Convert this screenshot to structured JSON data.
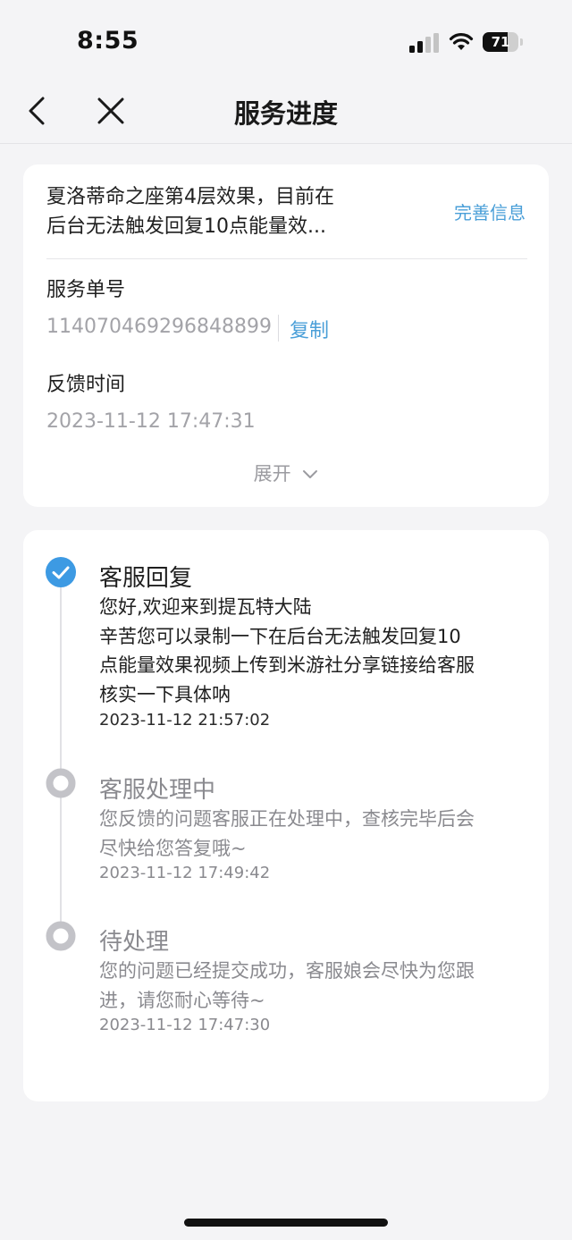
{
  "status_bar": {
    "time": "8:55",
    "battery_level": "71",
    "icons": [
      "signal-icon",
      "wifi-icon",
      "battery-icon"
    ]
  },
  "nav": {
    "title": "服务进度",
    "icons": [
      "back-icon",
      "close-icon"
    ]
  },
  "ticket": {
    "title_line1": "夏洛蒂命之座第4层效果，目前在",
    "title_line2": "后台无法触发回复10点能量效...",
    "complete_info_label": "完善信息",
    "service_number_label": "服务单号",
    "service_number": "114070469296848899",
    "copy_label": "复制",
    "feedback_time_label": "反馈时间",
    "feedback_time": "2023-11-12 17:47:31",
    "expand_label": "展开"
  },
  "timeline": [
    {
      "status": "客服回复",
      "desc_lines": [
        "您好,欢迎来到提瓦特大陆",
        "辛苦您可以录制一下在后台无法触发回复10",
        "点能量效果视频上传到米游社分享链接给客服",
        "核实一下具体呐"
      ],
      "time": "2023-11-12 21:57:02",
      "state": "done"
    },
    {
      "status": "客服处理中",
      "desc_lines": [
        "您反馈的问题客服正在处理中，查核完毕后会",
        "尽快给您答复哦~"
      ],
      "time": "2023-11-12 17:49:42",
      "state": "pending"
    },
    {
      "status": "待处理",
      "desc_lines": [
        "您的问题已经提交成功，客服娘会尽快为您跟",
        "进，请您耐心等待~"
      ],
      "time": "2023-11-12 17:47:30",
      "state": "pending"
    }
  ],
  "colors": {
    "accent": "#4a9fd8",
    "check": "#3d9ae3",
    "background": "#f4f4f6"
  }
}
